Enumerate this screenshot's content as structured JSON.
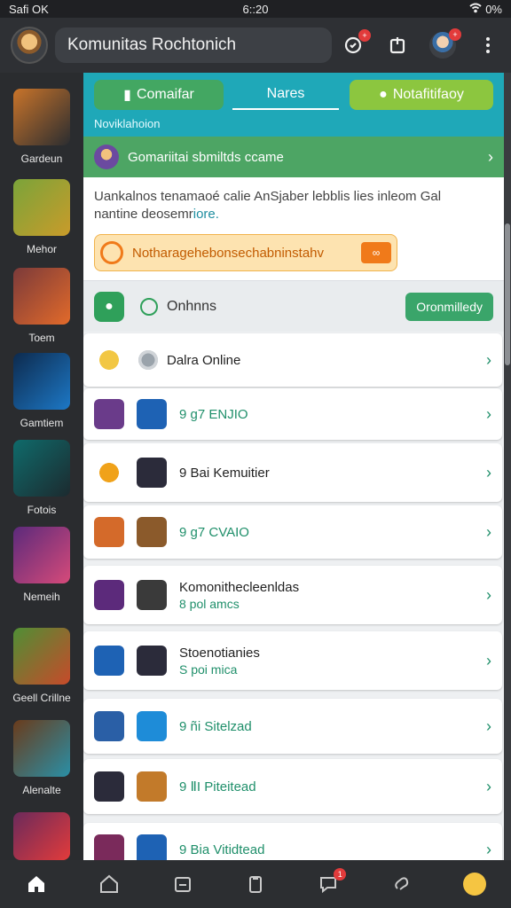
{
  "status": {
    "carrier": "Safi OK",
    "time": "6::20",
    "battery": "0%"
  },
  "topbar": {
    "search_text": "Komunitas Rochtonich",
    "badge1": "+",
    "badge2": "+"
  },
  "sidebar": {
    "items": [
      {
        "label": "Gardeun",
        "icon": "hero-thumbnail",
        "color": "#c9742a"
      },
      {
        "label": "Mehor",
        "icon": "hero-thumbnail",
        "color": "#7aa43a"
      },
      {
        "label": "Toem",
        "icon": "hero-thumbnail",
        "color": "#7b3a3a"
      },
      {
        "label": "Gamtiem",
        "icon": "arrow-thumbnail",
        "color": "#1d78c6"
      },
      {
        "label": "Fotois",
        "icon": "hero-thumbnail",
        "color": "#0f6b6b"
      },
      {
        "label": "Nemeih",
        "icon": "hero-thumbnail",
        "color": "#5b2a7b"
      },
      {
        "label": "Geell Crillne",
        "icon": "hero-thumbnail",
        "color": "#4f8f35"
      },
      {
        "label": "Alenalte",
        "icon": "hero-thumbnail",
        "color": "#6a3b1b"
      },
      {
        "label": "",
        "icon": "hero-thumbnail",
        "color": "#6b2a5b"
      }
    ]
  },
  "tabs": {
    "community": "Comaifar",
    "news": "Nares",
    "notifications": "Notafitifaoy"
  },
  "main": {
    "subheading": "Noviklahoion",
    "banner": "Gomariitai sbmiltds ccame",
    "notice_line1": "Uankalnos tenamaoé calie AnSjaber lebblis lies inleom Gal",
    "notice_line2a": "nantine deosemr",
    "notice_line2b": "iore.",
    "alert": "Notharagehebonsechabninstahv",
    "online_label": "Onhnns",
    "online_button": "Oronmilledy",
    "list": [
      {
        "t1": "Dalra Online",
        "t2": "",
        "colors": [
          "#f2c744",
          "#9aa3ab"
        ],
        "green": false
      },
      {
        "t1": "9 g7 ENJIO",
        "t2": "",
        "colors": [
          "#6a3b8a",
          "#1e62b4"
        ],
        "green": true
      },
      {
        "t1": "9 Bai Kemuitier",
        "t2": "",
        "colors": [
          "#f0a21a",
          "#2b2b3a"
        ],
        "green": false
      },
      {
        "t1": "9 g7 CVAIO",
        "t2": "",
        "colors": [
          "#d46a2a",
          "#8b5a2b"
        ],
        "green": true
      },
      {
        "t1": "Komonithecleenldas",
        "t2": "8 pol amcs",
        "colors": [
          "#5c2a7b",
          "#3a3a3a"
        ],
        "green": false
      },
      {
        "t1": "Stoenotianies",
        "t2": "S poi mica",
        "colors": [
          "#1e62b4",
          "#2b2b3a"
        ],
        "green": false
      },
      {
        "t1": "9 ñi Sitelzad",
        "t2": "",
        "colors": [
          "#2a5fa6",
          "#1e8cd8"
        ],
        "green": true
      },
      {
        "t1": "9 ⅡI Piteitead",
        "t2": "",
        "colors": [
          "#2b2b3a",
          "#c27a2a"
        ],
        "green": true
      },
      {
        "t1": "9 Bia Vitidtead",
        "t2": "",
        "colors": [
          "#7a2a5b",
          "#1e62b4"
        ],
        "green": true
      }
    ]
  },
  "bottom": {
    "notif_count": "1"
  }
}
